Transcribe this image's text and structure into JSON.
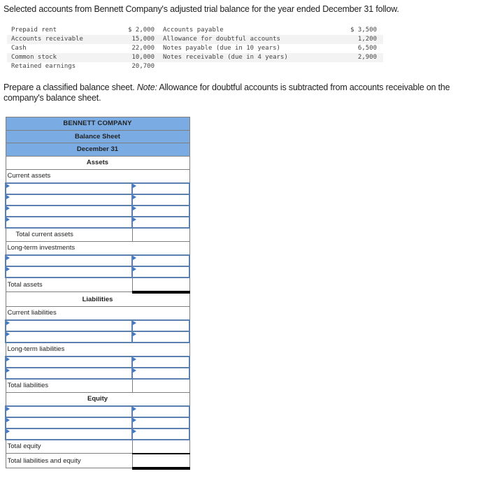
{
  "intro_text": "Selected accounts from Bennett Company's adjusted trial balance for the year ended December 31 follow.",
  "trial_balance": [
    {
      "left_account": "Prepaid rent",
      "left_amount": "$ 2,000",
      "right_account": "Accounts payable",
      "right_amount": "$ 3,500"
    },
    {
      "left_account": "Accounts receivable",
      "left_amount": "15,000",
      "right_account": "Allowance for doubtful accounts",
      "right_amount": "1,200"
    },
    {
      "left_account": "Cash",
      "left_amount": "22,000",
      "right_account": "Notes payable (due in 10 years)",
      "right_amount": "6,500"
    },
    {
      "left_account": "Common stock",
      "left_amount": "10,000",
      "right_account": "Notes receivable (due in 4 years)",
      "right_amount": "2,900"
    },
    {
      "left_account": "Retained earnings",
      "left_amount": "20,700",
      "right_account": "",
      "right_amount": ""
    }
  ],
  "instruction": {
    "text": "Prepare a classified balance sheet. ",
    "note_label": "Note:",
    "note_text": " Allowance for doubtful accounts is subtracted from accounts receivable on the company's balance sheet."
  },
  "balance_sheet": {
    "company": "BENNETT COMPANY",
    "statement": "Balance Sheet",
    "date": "December 31",
    "assets_heading": "Assets",
    "current_assets_label": "Current assets",
    "total_current_assets_label": "Total current assets",
    "long_term_investments_label": "Long-term investments",
    "total_assets_label": "Total assets",
    "liabilities_heading": "Liabilities",
    "current_liabilities_label": "Current liabilities",
    "long_term_liabilities_label": "Long-term liabilities",
    "total_liabilities_label": "Total liabilities",
    "equity_heading": "Equity",
    "total_equity_label": "Total equity",
    "total_liabilities_equity_label": "Total liabilities and equity",
    "colors": {
      "header_bg": "#7aabe3",
      "input_border": "#5b7fae",
      "dropdown_flag": "#3d78c8"
    }
  }
}
